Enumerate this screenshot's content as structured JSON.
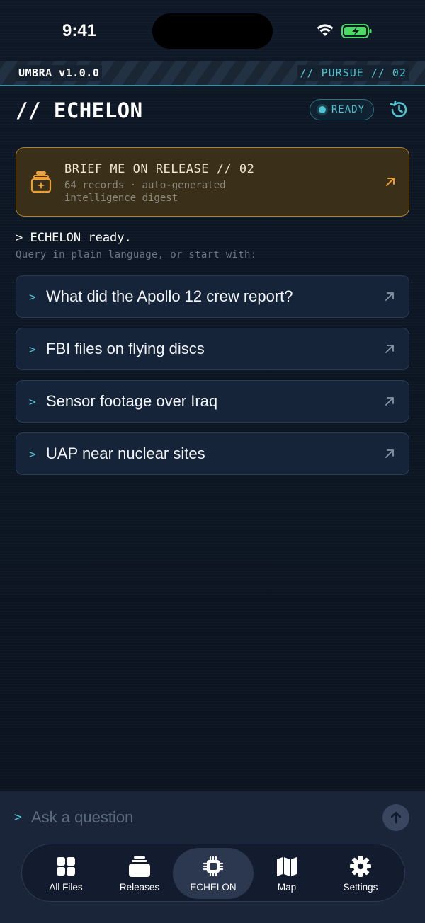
{
  "status": {
    "time": "9:41"
  },
  "banner": {
    "left": "UMBRA v1.0.0",
    "right": "// PURSUE // 02"
  },
  "header": {
    "title": "// ECHELON",
    "status_badge": "READY"
  },
  "brief": {
    "title": "BRIEF ME ON RELEASE // 02",
    "subtitle": "64 records · auto-generated intelligence digest"
  },
  "console": {
    "prompt": "> ECHELON ready.",
    "hint": "Query in plain language, or start with:"
  },
  "suggestions": [
    {
      "label": "What did the Apollo 12 crew report?"
    },
    {
      "label": "FBI files on flying discs"
    },
    {
      "label": "Sensor footage over Iraq"
    },
    {
      "label": "UAP near nuclear sites"
    }
  ],
  "ask": {
    "chevron": ">",
    "placeholder": "Ask a question"
  },
  "tabs": [
    {
      "label": "All Files",
      "icon": "grid-icon"
    },
    {
      "label": "Releases",
      "icon": "stack-icon"
    },
    {
      "label": "ECHELON",
      "icon": "chip-icon",
      "active": true
    },
    {
      "label": "Map",
      "icon": "map-icon"
    },
    {
      "label": "Settings",
      "icon": "gear-icon"
    }
  ],
  "colors": {
    "accent": "#4fc3d1",
    "warning": "#f0a030",
    "background": "#0b1320",
    "battery": "#4cd964"
  }
}
